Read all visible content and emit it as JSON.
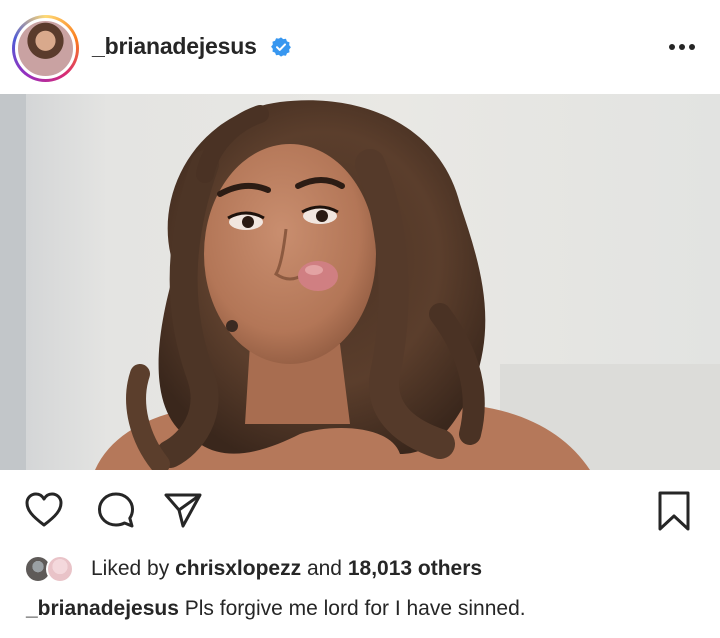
{
  "post": {
    "username": "_brianadejesus",
    "verified": true,
    "accent": "#3897f0"
  },
  "actions": {
    "like_icon": "heart-icon",
    "comment_icon": "comment-icon",
    "share_icon": "paper-plane-icon",
    "save_icon": "bookmark-icon"
  },
  "likes": {
    "prefix": "Liked by",
    "user": "chrisxlopezz",
    "connector": "and",
    "others": "18,013 others"
  },
  "caption": {
    "username": "_brianadejesus",
    "text": "Pls forgive me lord for I have sinned."
  }
}
